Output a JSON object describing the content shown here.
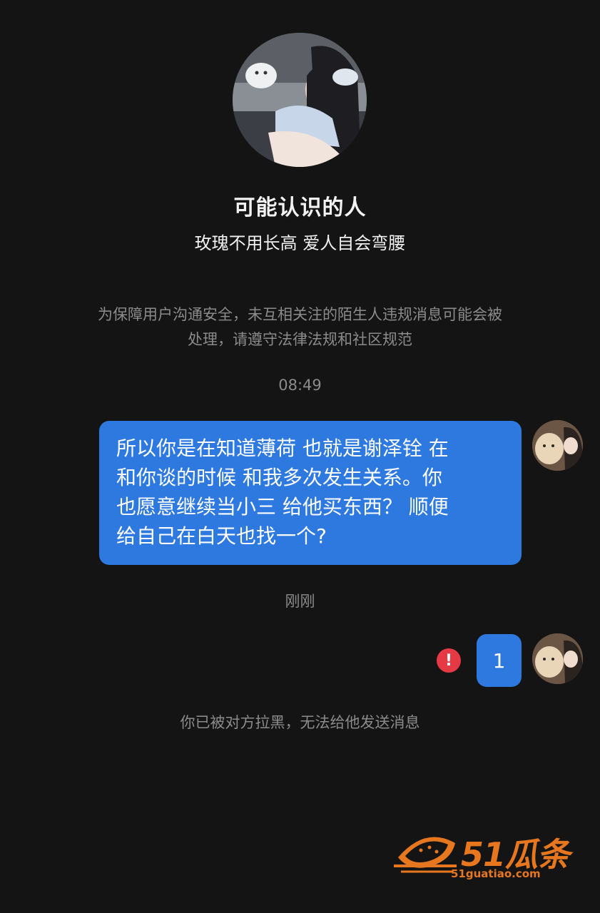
{
  "profile": {
    "title": "可能认识的人",
    "bio": "玫瑰不用长高 爱人自会弯腰"
  },
  "notice": {
    "line1": "为保障用户沟通安全，未互相关注的陌生人违规消息可能会被",
    "line2": "处理，请遵守法律法规和社区规范"
  },
  "messages": [
    {
      "time": "08:49",
      "lines": [
        "所以你是在知道薄荷 也就是谢泽铨 在",
        "和你谈的时候 和我多次发生关系。你",
        "也愿意继续当小三 给他买东西？ 顺便",
        "给自己在白天也找一个?"
      ]
    },
    {
      "time": "刚刚",
      "text": "1",
      "status_icon": "error-icon"
    }
  ],
  "blocked_notice": "你已被对方拉黑，无法给他发送消息",
  "watermark": {
    "brand": "51瓜条",
    "url": "51guatiao.com",
    "icon": "watermelon-logo-icon"
  },
  "colors": {
    "background": "#141414",
    "bubble": "#2e79e0",
    "error": "#e53945",
    "muted_text": "#8b8b8b",
    "watermark": "#e6771e"
  }
}
